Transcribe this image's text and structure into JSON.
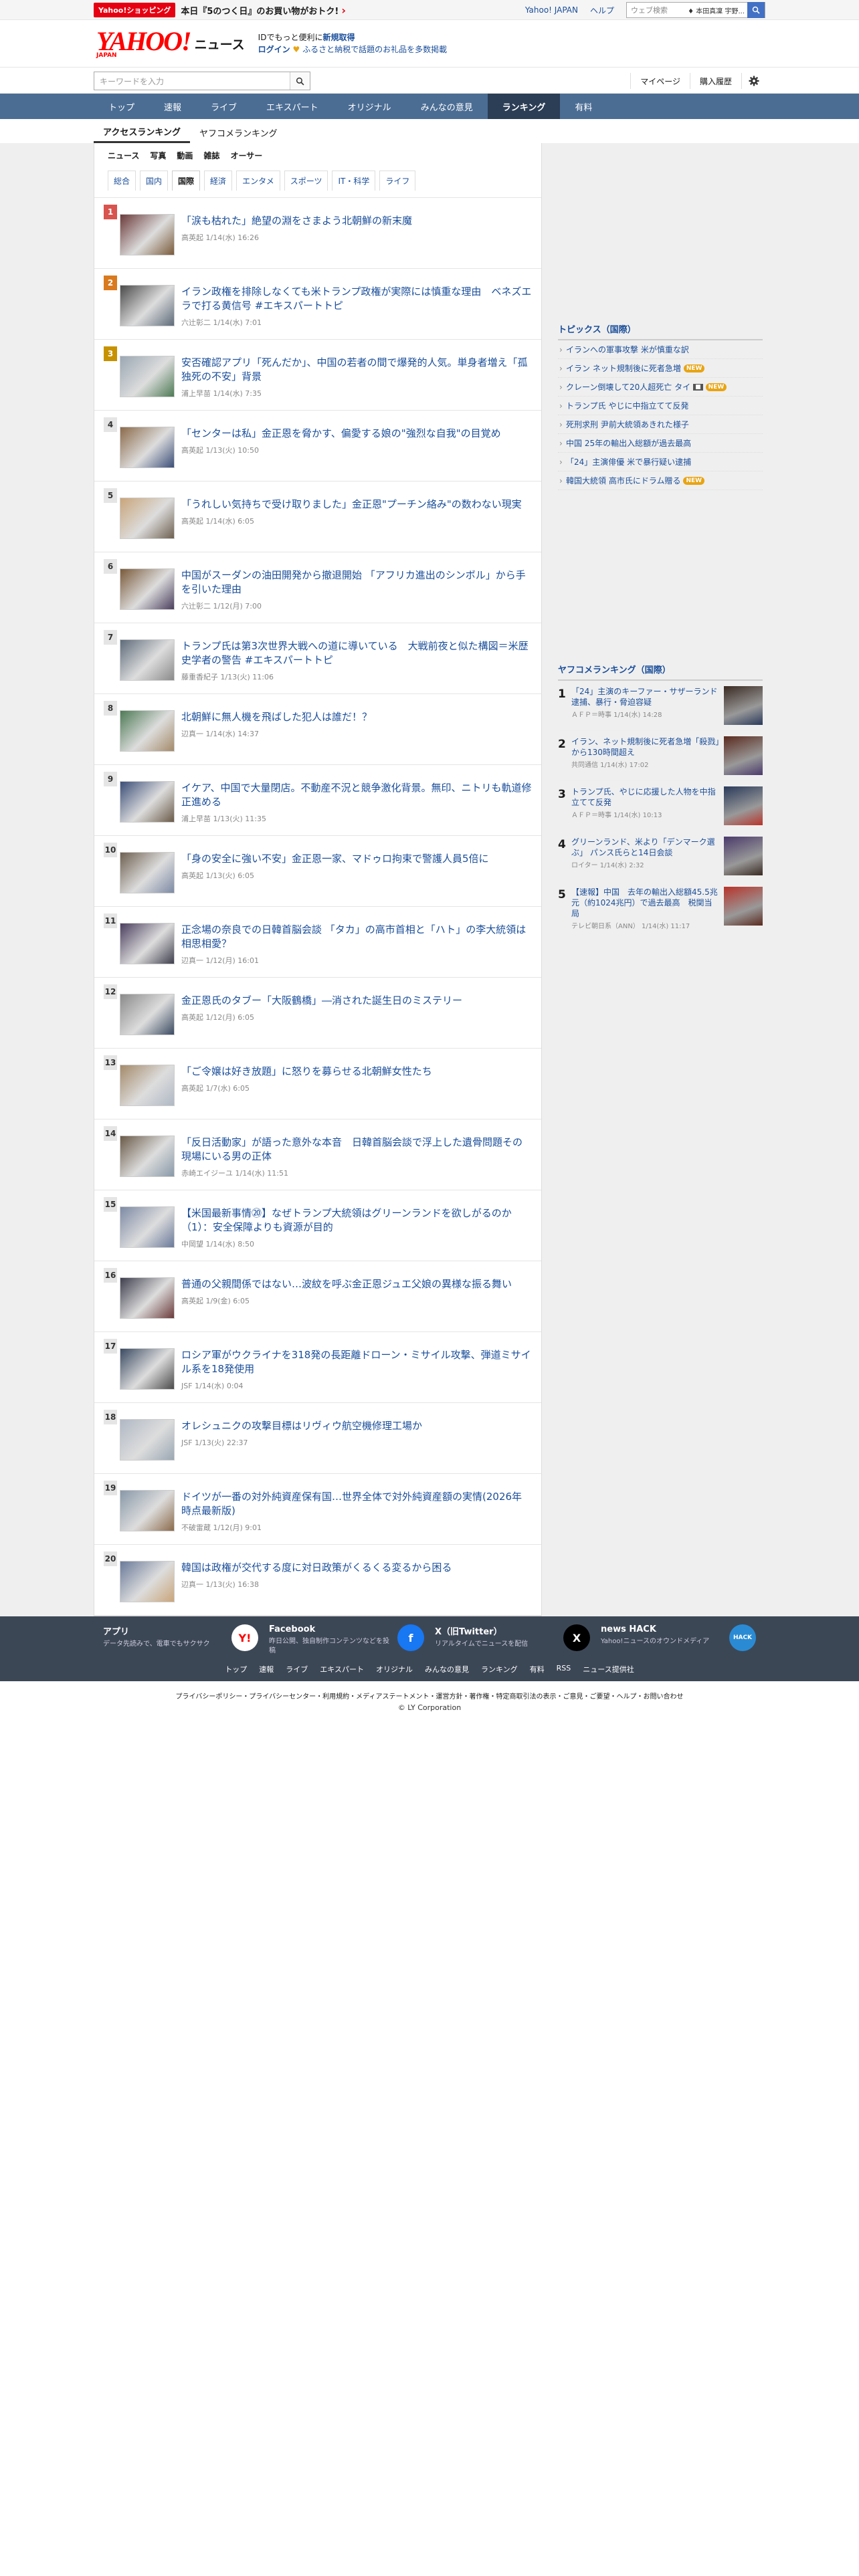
{
  "promo": {
    "badge": "Yahoo!ショッピング",
    "text": "本日『5のつく日』のお買い物がおトク!",
    "arrow": "›"
  },
  "utility": {
    "yahoo_japan": "Yahoo! JAPAN",
    "help": "ヘルプ",
    "web_search_placeholder": "ウェブ検索",
    "web_search_preview": "♦ 本田真凜 宇野..."
  },
  "header": {
    "logo": "YAHOO!",
    "logo_sub": "JAPAN",
    "service": "ニュース",
    "note1": "IDでもっと便利に",
    "note1_link": "新規取得",
    "note2_login": "ログイン",
    "note2_text": "ふるさと納税で話題のお礼品を多数掲載"
  },
  "search": {
    "placeholder": "キーワードを入力",
    "mypage": "マイページ",
    "history": "購入履歴"
  },
  "nav": [
    "トップ",
    "速報",
    "ライブ",
    "エキスパート",
    "オリジナル",
    "みんなの意見",
    "ランキング",
    "有料"
  ],
  "nav_active": "ランキング",
  "subtabs": [
    "アクセスランキング",
    "ヤフコメランキング"
  ],
  "categories": [
    "ニュース",
    "写真",
    "動画",
    "雑誌",
    "オーサー"
  ],
  "genres": [
    "総合",
    "国内",
    "国際",
    "経済",
    "エンタメ",
    "スポーツ",
    "IT・科学",
    "ライフ"
  ],
  "genre_active": "国際",
  "ranking": [
    {
      "rank": "1",
      "title": "「涙も枯れた」絶望の淵をさまよう北朝鮮の新末魔",
      "meta": "高英起 1/14(水) 16:26"
    },
    {
      "rank": "2",
      "title": "イラン政権を排除しなくても米トランプ政権が実際には慎重な理由　ベネズエラで打る黄信号 #エキスパートトピ",
      "meta": "六辻彰二 1/14(水) 7:01"
    },
    {
      "rank": "3",
      "title": "安否確認アプリ「死んだか」、中国の若者の間で爆発的人気。単身者増え「孤独死の不安」背景",
      "meta": "浦上早苗 1/14(水) 7:35"
    },
    {
      "rank": "4",
      "title": "「センターは私」金正恩を脅かす、偏愛する娘の\"強烈な自我\"の目覚め",
      "meta": "高英起 1/13(火) 10:50"
    },
    {
      "rank": "5",
      "title": "「うれしい気持ちで受け取りました」金正恩\"プーチン絡み\"の数わない現実",
      "meta": "高英起 1/14(水) 6:05"
    },
    {
      "rank": "6",
      "title": "中国がスーダンの油田開発から撤退開始 「アフリカ進出のシンボル」から手を引いた理由",
      "meta": "六辻彰二 1/12(月) 7:00"
    },
    {
      "rank": "7",
      "title": "トランプ氏は第3次世界大戦への道に導いている　大戦前夜と似た構図＝米歴史学者の警告 #エキスパートトピ",
      "meta": "藤重香紀子 1/13(火) 11:06"
    },
    {
      "rank": "8",
      "title": "北朝鮮に無人機を飛ばした犯人は誰だ！？",
      "meta": "辺真一 1/14(水) 14:37"
    },
    {
      "rank": "9",
      "title": "イケア、中国で大量閉店。不動産不況と競争激化背景。無印、ニトリも軌道修正進める",
      "meta": "浦上早苗 1/13(火) 11:35"
    },
    {
      "rank": "10",
      "title": "「身の安全に強い不安」金正恩一家、マドゥロ拘束で警護人員5倍に",
      "meta": "高英起 1/13(火) 6:05"
    },
    {
      "rank": "11",
      "title": "正念場の奈良での日韓首脳会談 「タカ」の高市首相と「ハト」の李大統領は相思相愛？",
      "meta": "辺真一 1/12(月) 16:01"
    },
    {
      "rank": "12",
      "title": "金正恩氏のタブー「大阪鶴橋」―消された誕生日のミステリー",
      "meta": "高英起 1/12(月) 6:05"
    },
    {
      "rank": "13",
      "title": "「ご令嬢は好き放題」に怒りを募らせる北朝鮮女性たち",
      "meta": "高英起 1/7(水) 6:05"
    },
    {
      "rank": "14",
      "title": "「反日活動家」が語った意外な本音　日韓首脳会談で浮上した遺骨問題その現場にいる男の正体",
      "meta": "赤崎エイジーユ 1/14(水) 11:51"
    },
    {
      "rank": "15",
      "title": "【米国最新事情⑳】なぜトランプ大統領はグリーンランドを欲しがるのか（1）：安全保障よりも資源が目的",
      "meta": "中岡望 1/14(水) 8:50"
    },
    {
      "rank": "16",
      "title": "普通の父親間係ではない…波紋を呼ぶ金正恩ジュエ父娘の異様な振る舞い",
      "meta": "高英起 1/9(金) 6:05"
    },
    {
      "rank": "17",
      "title": "ロシア軍がウクライナを318発の長距離ドローン・ミサイル攻撃、弾道ミサイル系を18発使用",
      "meta": "JSF 1/14(水) 0:04"
    },
    {
      "rank": "18",
      "title": "オレシュニクの攻撃目標はリヴィウ航空機修理工場か",
      "meta": "JSF 1/13(火) 22:37"
    },
    {
      "rank": "19",
      "title": "ドイツが一番の対外純資産保有国…世界全体で対外純資産額の実情(2026年時点最新版)",
      "meta": "不破雷蔵 1/12(月) 9:01"
    },
    {
      "rank": "20",
      "title": "韓国は政権が交代する度に対日政策がくるくる変るから困る",
      "meta": "辺真一 1/13(火) 16:38"
    }
  ],
  "topics": {
    "heading": "トピックス（国際）",
    "items": [
      {
        "text": "イランへの軍事攻撃 米が慎重な訳",
        "badge": ""
      },
      {
        "text": "イラン ネット規制後に死者急増",
        "badge": "NEW"
      },
      {
        "text": "クレーン倒壊して20人超死亡 タイ",
        "badge": "NEW",
        "img": "■"
      },
      {
        "text": "トランプ氏 やじに中指立てて反発",
        "badge": ""
      },
      {
        "text": "死刑求刑 尹前大統領あきれた様子",
        "badge": ""
      },
      {
        "text": "中国 25年の輸出入総額が過去最高",
        "badge": ""
      },
      {
        "text": "「24」主演俳優 米で暴行疑い逮捕",
        "badge": ""
      },
      {
        "text": "韓国大統領 高市氏にドラム贈る",
        "badge": "NEW"
      }
    ]
  },
  "yrank": {
    "heading": "ヤフコメランキング（国際）",
    "items": [
      {
        "rank": "1",
        "title": "「24」主演のキーファー・サザーランド逮捕、暴行・脅迫容疑",
        "meta": "ＡＦＰ＝時事 1/14(水) 14:28"
      },
      {
        "rank": "2",
        "title": "イラン、ネット規制後に死者急増「殺戮」から130時間超え",
        "meta": "共同通信 1/14(水) 17:02"
      },
      {
        "rank": "3",
        "title": "トランプ氏、やじに応援した人物を中指立てて反発",
        "meta": "ＡＦＰ＝時事 1/14(水) 10:13"
      },
      {
        "rank": "4",
        "title": "グリーンランド、米より「デンマーク選ぶ」 パンス氏らと14日会談",
        "meta": "ロイター 1/14(水) 2:32"
      },
      {
        "rank": "5",
        "title": "【速報】中国　去年の輸出入総額45.5兆元（約1024兆円）で過去最高　税関当局",
        "meta": "テレビ朝日系（ANN） 1/14(水) 11:17"
      }
    ]
  },
  "footer": {
    "apps": [
      {
        "name": "アプリ",
        "desc": "データ先読みで、電車でもサクサク",
        "icon": "Y!",
        "color": "#ffffff"
      },
      {
        "name": "Facebook",
        "desc": "昨日公開、独自制作コンテンツなどを投稿",
        "icon": "f",
        "color": "#1877f2"
      },
      {
        "name": "X（旧Twitter）",
        "desc": "リアルタイムでニュースを配信",
        "icon": "X",
        "color": "#000000"
      },
      {
        "name": "news HACK",
        "desc": "Yahoo!ニュースのオウンドメディア",
        "icon": "HACK",
        "color": "#2a8bd4"
      }
    ],
    "nav": [
      "トップ",
      "速報",
      "ライブ",
      "エキスパート",
      "オリジナル",
      "みんなの意見",
      "ランキング",
      "有料",
      "RSS",
      "ニュース提供社"
    ],
    "legal": "プライバシーポリシー・プライバシーセンター・利用規約・メディアステートメント・運営方針・著作権・特定商取引法の表示・ご意見・ご要望・ヘルプ・お問い合わせ",
    "copyright": "© LY Corporation"
  }
}
